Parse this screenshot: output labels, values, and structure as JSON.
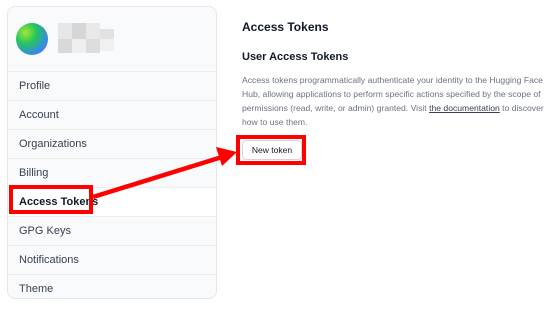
{
  "sidebar": {
    "items": [
      {
        "label": "Profile"
      },
      {
        "label": "Account"
      },
      {
        "label": "Organizations"
      },
      {
        "label": "Billing"
      },
      {
        "label": "Access Tokens",
        "active": true
      },
      {
        "label": "GPG Keys"
      },
      {
        "label": "Notifications"
      },
      {
        "label": "Theme"
      }
    ]
  },
  "main": {
    "title": "Access Tokens",
    "section_title": "User Access Tokens",
    "description_before_link": "Access tokens programmatically authenticate your identity to the Hugging Face Hub, allowing applications to perform specific actions specified by the scope of permissions (read, write, or admin) granted. Visit ",
    "link_text": "the documentation",
    "description_after_link": " to discover how to use them.",
    "new_token_label": "New token"
  },
  "annotation": {
    "highlight_color": "#ff0000"
  },
  "colors": {
    "accent_text": "#111827",
    "muted_text": "#6b7280"
  }
}
